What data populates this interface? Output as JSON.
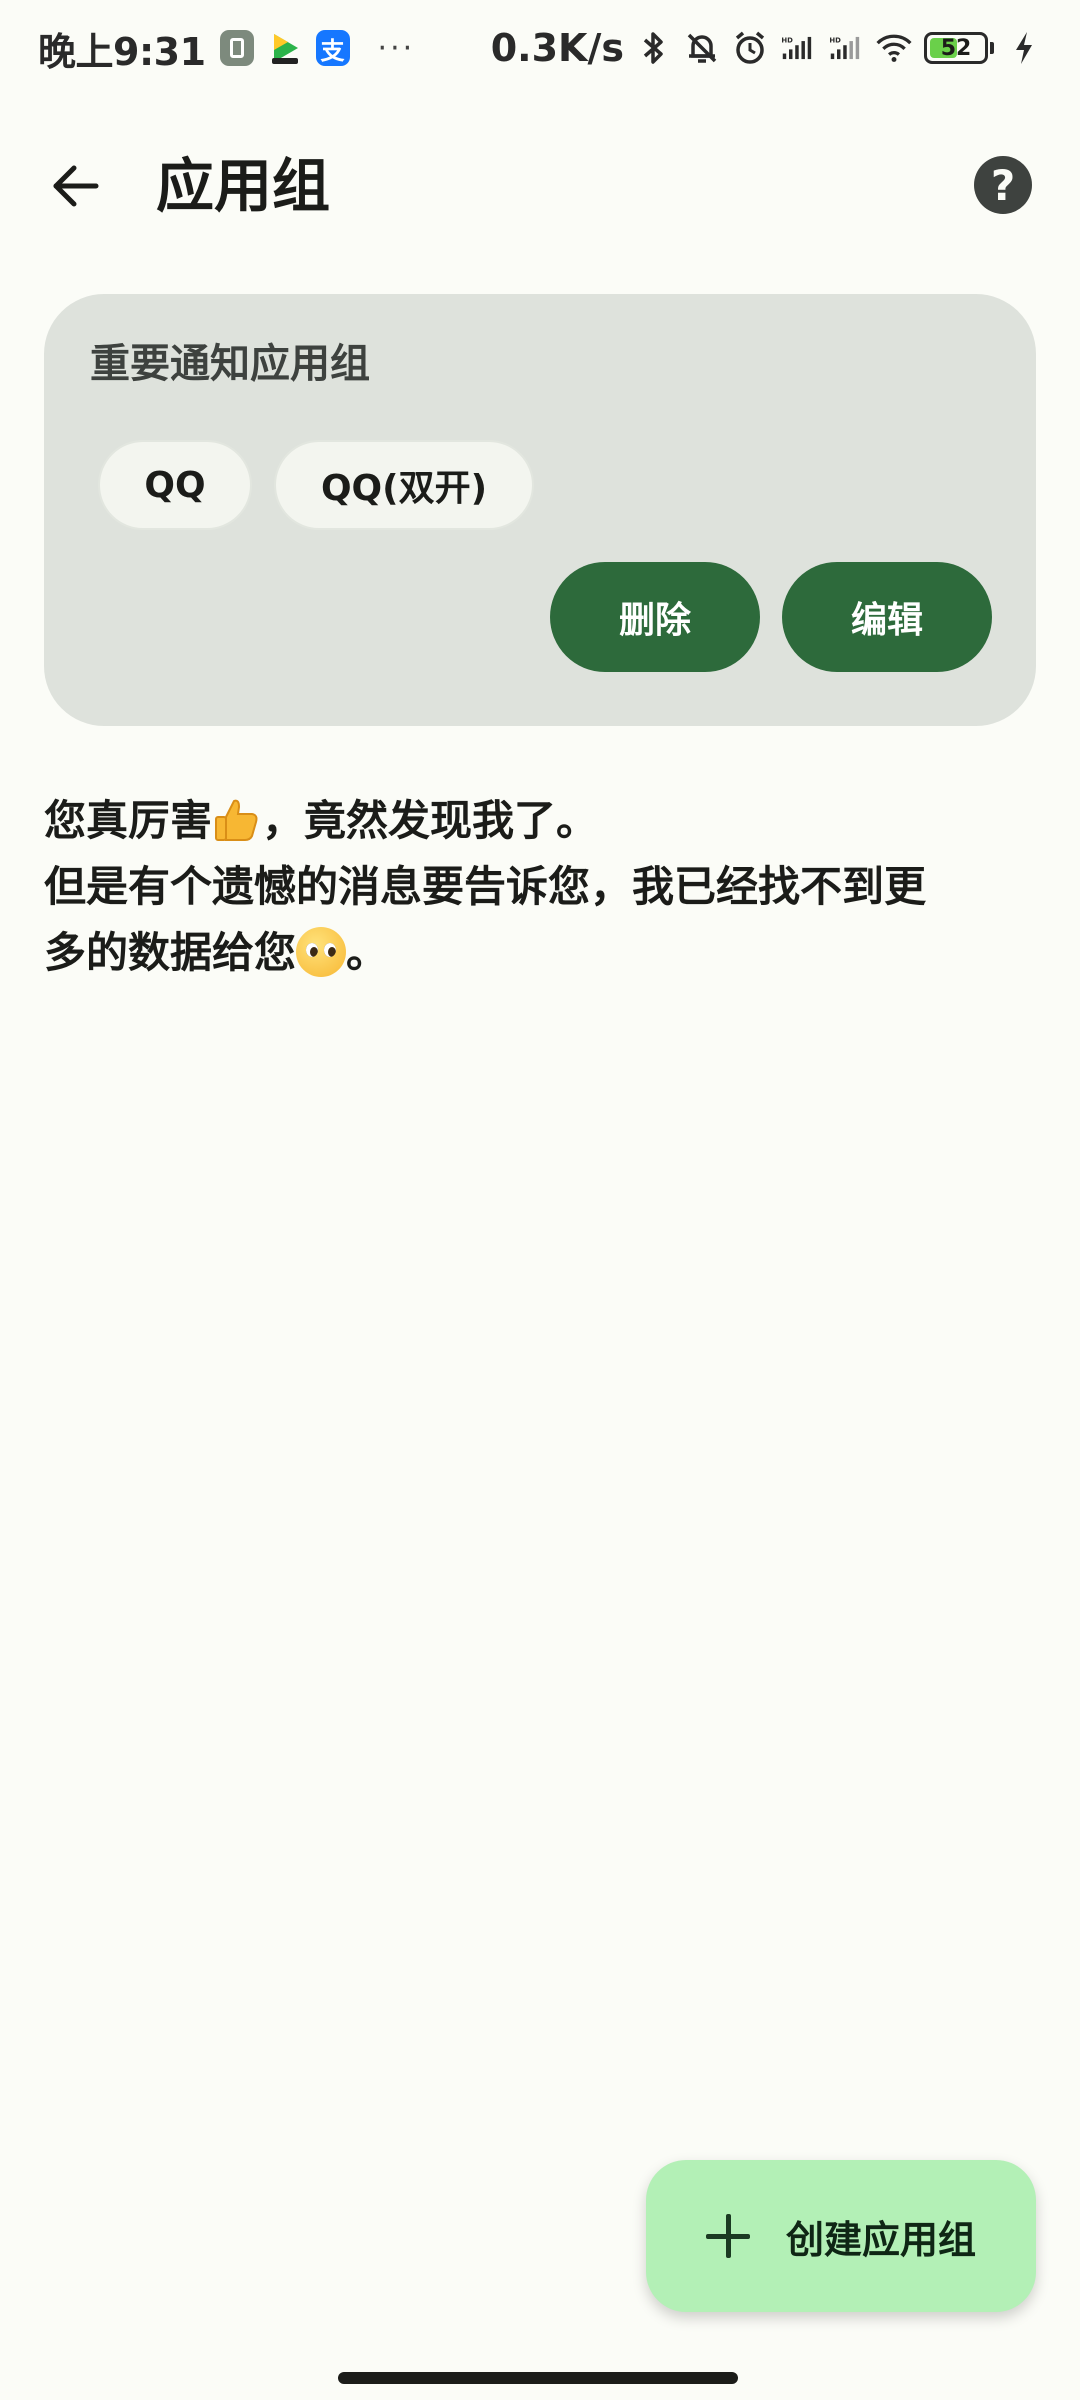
{
  "status_bar": {
    "time": "晚上9:31",
    "notification_icons": [
      "screen-recorder-icon",
      "video-app-icon",
      "alipay-icon"
    ],
    "alipay_glyph": "支",
    "more": "···",
    "net_speed": "0.3K/s",
    "battery_level": "52",
    "battery_percent": 52
  },
  "app_bar": {
    "title": "应用组",
    "help_glyph": "?"
  },
  "group_card": {
    "name": "重要通知应用组",
    "apps": [
      "QQ",
      "QQ(双开)"
    ],
    "delete_label": "删除",
    "edit_label": "编辑"
  },
  "message": {
    "line1_a": "您真厉害",
    "line1_b": "，竟然发现我了。",
    "line2": "但是有个遗憾的消息要告诉您，我已经找不到更",
    "line3_a": "多的数据给您",
    "line3_b": "。"
  },
  "fab": {
    "label": "创建应用组"
  },
  "colors": {
    "background": "#fbfcf7",
    "card": "#dee2dc",
    "primary_button": "#2d6a3b",
    "fab": "#b3f0b6"
  }
}
